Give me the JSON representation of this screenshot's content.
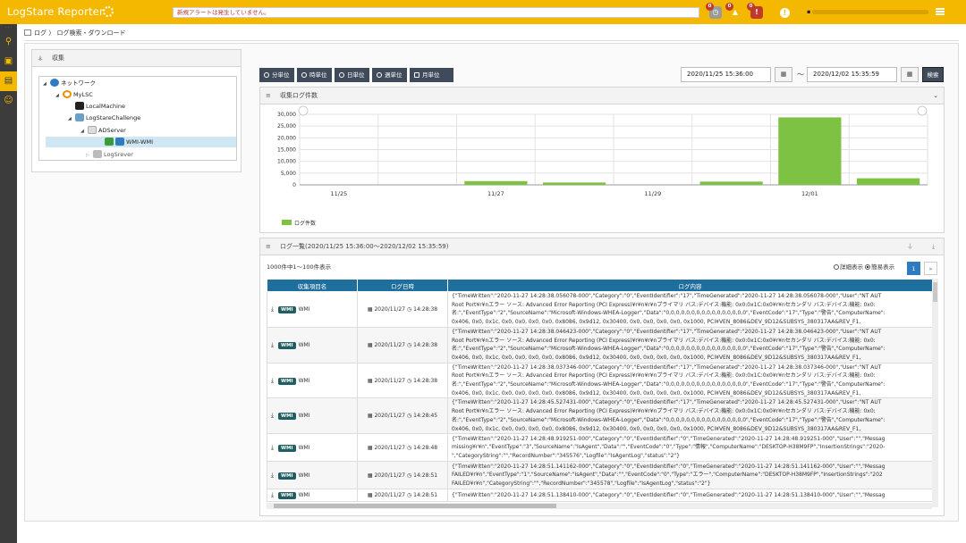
{
  "header": {
    "app_title": "LogStare Reporter",
    "alert_message": "新規アラートは発生していません。",
    "badges": [
      "0",
      "0",
      "0"
    ],
    "user_label": "",
    "info_label": "!"
  },
  "sidebar": {
    "dots": "· · ·"
  },
  "breadcrumb": {
    "root": "ログ",
    "sep": "〉",
    "current": "ログ検索・ダウンロード"
  },
  "collection_panel": {
    "title": "収集",
    "tree": [
      {
        "label": "ネットワーク",
        "level": 0
      },
      {
        "label": "MyLSC",
        "level": 1
      },
      {
        "label": "LocalMachine",
        "level": 2
      },
      {
        "label": "LogStareChallenge",
        "level": 2
      },
      {
        "label": "ADServer",
        "level": 3
      },
      {
        "label": "WMI-WMI",
        "level": 4,
        "selected": true
      },
      {
        "label": "LogSrever",
        "level": 3
      }
    ]
  },
  "toolbar": {
    "units": [
      "分単位",
      "時単位",
      "日単位",
      "週単位",
      "月単位"
    ],
    "date_from": "2020/11/25 15:36:00",
    "tilde": "～",
    "date_to": "2020/12/02 15:35:59",
    "search_label": "検索"
  },
  "chart_panel": {
    "title": "収集ログ件数"
  },
  "chart_data": {
    "type": "bar",
    "categories": [
      "11/25",
      "11/26",
      "11/27",
      "11/28",
      "11/29",
      "11/30",
      "12/01",
      "12/02"
    ],
    "x_tick_labels": [
      "11/25",
      "11/27",
      "11/29",
      "12/01"
    ],
    "series": [
      {
        "name": "ログ件数",
        "values": [
          0,
          0,
          1600,
          1000,
          0,
          1400,
          28700,
          2800
        ]
      }
    ],
    "ylim": [
      0,
      30000
    ],
    "y_ticks": [
      "0",
      "5,000",
      "10,000",
      "15,000",
      "20,000",
      "25,000",
      "30,000"
    ],
    "grid": true,
    "legend_position": "bottom-left",
    "color": "#7dc242"
  },
  "list_panel": {
    "title": "ログ一覧(2020/11/25 15:36:00〜2020/12/02 15:35:59)",
    "count_text": "1000件中1〜100件表示",
    "view_detail": "詳細表示",
    "view_simple": "簡易表示",
    "page_current": "1",
    "page_next": "»",
    "columns": [
      "収集項目名",
      "ログ日時",
      "ログ内容"
    ],
    "rows": [
      {
        "badge": "WMI",
        "name": "WMI",
        "date": "2020/11/27",
        "time": "14:28:38",
        "content": "{\"TimeWritten\":\"2020-11-27 14:28:38.056078-000\",\"Category\":\"0\",\"EventIdentifier\":\"17\",\"TimeGenerated\":\"2020-11-27 14:28:38.056078-000\",\"User\":\"NT AUT\nRoot Port¥r¥nエラー ソース: Advanced Error Reporting (PCI Express)¥r¥n¥r¥nプライマリ バス:デバイス:機能: 0x0:0x1C:0x0¥r¥nセカンダリ バス:デバイス:機能: 0x0:\n名:\",\"EventType\":\"2\",\"SourceName\":\"Microsoft-Windows-WHEA-Logger\",\"Data\":\"0,0,0,0,0,0,0,0,0,0,0,0,0,0,0,0\",\"EventCode\":\"17\",\"Type\":\"警告\",\"ComputerName\":\n0x406, 0x0, 0x1c, 0x0, 0x0, 0x0, 0x0, 0x8086, 0x9d12, 0x30400, 0x0, 0x0, 0x0, 0x0, 0x1000, PCI¥VEN_8086&DEV_9D12&SUBSYS_380317AA&REV_F1,"
      },
      {
        "badge": "WMI",
        "name": "WMI",
        "date": "2020/11/27",
        "time": "14:28:38",
        "content": "{\"TimeWritten\":\"2020-11-27 14:28:38.046423-000\",\"Category\":\"0\",\"EventIdentifier\":\"17\",\"TimeGenerated\":\"2020-11-27 14:28:38.046423-000\",\"User\":\"NT AUT\nRoot Port¥r¥nエラー ソース: Advanced Error Reporting (PCI Express)¥r¥n¥r¥nプライマリ バス:デバイス:機能: 0x0:0x1C:0x0¥r¥nセカンダリ バス:デバイス:機能: 0x0:\n名:\",\"EventType\":\"2\",\"SourceName\":\"Microsoft-Windows-WHEA-Logger\",\"Data\":\"0,0,0,0,0,0,0,0,0,0,0,0,0,0,0,0\",\"EventCode\":\"17\",\"Type\":\"警告\",\"ComputerName\":\n0x406, 0x0, 0x1c, 0x0, 0x0, 0x0, 0x0, 0x8086, 0x9d12, 0x30400, 0x0, 0x0, 0x0, 0x0, 0x1000, PCI¥VEN_8086&DEV_9D12&SUBSYS_380317AA&REV_F1,"
      },
      {
        "badge": "WMI",
        "name": "WMI",
        "date": "2020/11/27",
        "time": "14:28:38",
        "content": "{\"TimeWritten\":\"2020-11-27 14:28:38.037346-000\",\"Category\":\"0\",\"EventIdentifier\":\"17\",\"TimeGenerated\":\"2020-11-27 14:28:38.037346-000\",\"User\":\"NT AUT\nRoot Port¥r¥nエラー ソース: Advanced Error Reporting (PCI Express)¥r¥n¥r¥nプライマリ バス:デバイス:機能: 0x0:0x1C:0x0¥r¥nセカンダリ バス:デバイス:機能: 0x0:\n名:\",\"EventType\":\"2\",\"SourceName\":\"Microsoft-Windows-WHEA-Logger\",\"Data\":\"0,0,0,0,0,0,0,0,0,0,0,0,0,0,0,0\",\"EventCode\":\"17\",\"Type\":\"警告\",\"ComputerName\":\n0x406, 0x0, 0x1c, 0x0, 0x0, 0x0, 0x0, 0x8086, 0x9d12, 0x30400, 0x0, 0x0, 0x0, 0x0, 0x1000, PCI¥VEN_8086&DEV_9D12&SUBSYS_380317AA&REV_F1,"
      },
      {
        "badge": "WMI",
        "name": "WMI",
        "date": "2020/11/27",
        "time": "14:28:45",
        "content": "{\"TimeWritten\":\"2020-11-27 14:28:45.527431-000\",\"Category\":\"0\",\"EventIdentifier\":\"17\",\"TimeGenerated\":\"2020-11-27 14:28:45.527431-000\",\"User\":\"NT AUT\nRoot Port¥r¥nエラー ソース: Advanced Error Reporting (PCI Express)¥r¥n¥r¥nプライマリ バス:デバイス:機能: 0x0:0x1C:0x0¥r¥nセカンダリ バス:デバイス:機能: 0x0:\n名:\",\"EventType\":\"2\",\"SourceName\":\"Microsoft-Windows-WHEA-Logger\",\"Data\":\"0,0,0,0,0,0,0,0,0,0,0,0,0,0,0,0\",\"EventCode\":\"17\",\"Type\":\"警告\",\"ComputerName\":\n0x406, 0x0, 0x1c, 0x0, 0x0, 0x0, 0x0, 0x8086, 0x9d12, 0x30400, 0x0, 0x0, 0x0, 0x0, 0x1000, PCI¥VEN_8086&DEV_9D12&SUBSYS_380317AA&REV_F1,"
      },
      {
        "badge": "WMI",
        "name": "WMI",
        "date": "2020/11/27",
        "time": "14:28:48",
        "content": "{\"TimeWritten\":\"2020-11-27 14:28:48.919251-000\",\"Category\":\"0\",\"EventIdentifier\":\"0\",\"TimeGenerated\":\"2020-11-27 14:28:48.919251-000\",\"User\":\"\",\"Messag\nmissing¥r¥n\",\"EventType\":\"3\",\"SourceName\":\"IsAgent\",\"Data\":\"\",\"EventCode\":\"0\",\"Type\":\"情報\",\"ComputerName\":\"DESKTOP-H38M9FP\",\"InsertionStrings\":\"2020-\n\",\"CategoryString\":\"\",\"RecordNumber\":\"345576\",\"Logfile\":\"IsAgentLog\",\"status\":\"2\"}"
      },
      {
        "badge": "WMI",
        "name": "WMI",
        "date": "2020/11/27",
        "time": "14:28:51",
        "content": "{\"TimeWritten\":\"2020-11-27 14:28:51.141162-000\",\"Category\":\"0\",\"EventIdentifier\":\"0\",\"TimeGenerated\":\"2020-11-27 14:28:51.141162-000\",\"User\":\"\",\"Messag\nFAILED¥r¥n\",\"EventType\":\"1\",\"SourceName\":\"IsAgent\",\"Data\":\"\",\"EventCode\":\"0\",\"Type\":\"エラー\",\"ComputerName\":\"DESKTOP-H38M9FP\",\"InsertionStrings\":\"202\nFAILED¥r¥n\",\"CategoryString\":\"\",\"RecordNumber\":\"345578\",\"Logfile\":\"IsAgentLog\",\"status\":\"2\"}"
      },
      {
        "badge": "WMI",
        "name": "WMI",
        "date": "2020/11/27",
        "time": "14:28:51",
        "content": "{\"TimeWritten\":\"2020-11-27 14:28:51.138410-000\",\"Category\":\"0\",\"EventIdentifier\":\"0\",\"TimeGenerated\":\"2020-11-27 14:28:51.138410-000\",\"User\":\"\",\"Messag"
      }
    ]
  }
}
